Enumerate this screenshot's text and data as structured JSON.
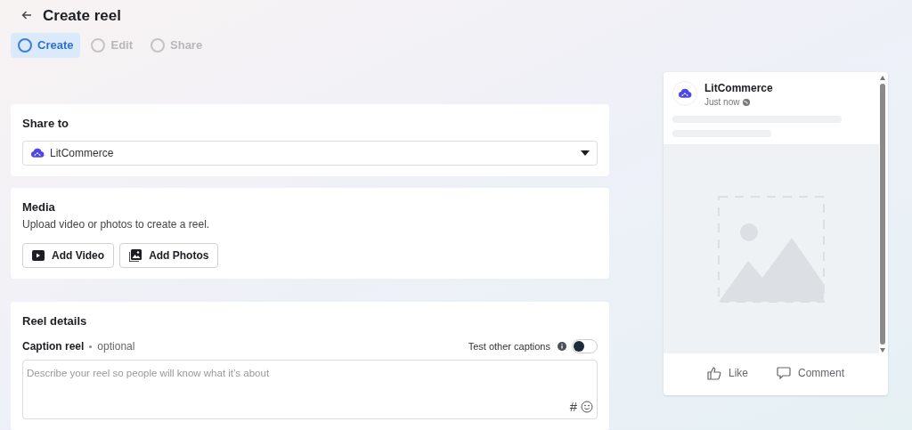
{
  "header": {
    "title": "Create reel"
  },
  "steps": [
    {
      "label": "Create",
      "selected": true
    },
    {
      "label": "Edit",
      "selected": false
    },
    {
      "label": "Share",
      "selected": false
    }
  ],
  "share_to": {
    "heading": "Share to",
    "value": "LitCommerce"
  },
  "media": {
    "heading": "Media",
    "description": "Upload video or photos to create a reel.",
    "buttons": [
      {
        "kind": "video",
        "label": "Add Video"
      },
      {
        "kind": "photos",
        "label": "Add Photos"
      }
    ]
  },
  "reel_details": {
    "heading": "Reel details",
    "caption_label": "Caption reel",
    "caption_hint": "optional",
    "test_captions": {
      "label": "Test other captions",
      "on": false
    },
    "caption_field": {
      "placeholder": "Describe your reel so people will know what it’s about"
    },
    "hashtag": "#"
  },
  "preview": {
    "name": "LitCommerce",
    "time": "Just now",
    "actions": [
      {
        "kind": "like",
        "label": "Like"
      },
      {
        "kind": "comment",
        "label": "Comment"
      }
    ]
  }
}
